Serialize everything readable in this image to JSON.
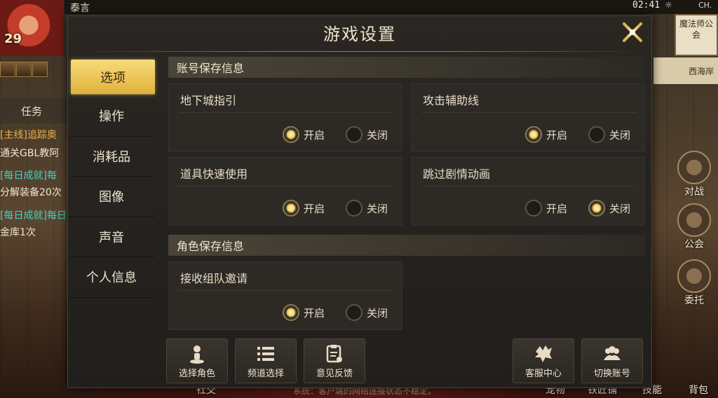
{
  "status_bar": {
    "player_name": "泰言",
    "time": "02:41",
    "status_icon": "☼",
    "carrier": "CH."
  },
  "player": {
    "level": "29"
  },
  "left_panel": {
    "task_tab": "任务",
    "quests": [
      {
        "tag": "[主线]",
        "text": "追踪奥"
      },
      {
        "tag": "",
        "text": "通关GBL教阿"
      },
      {
        "tag": "[每日成就]",
        "text": "每"
      },
      {
        "tag": "",
        "text": "分解装备20次"
      },
      {
        "tag": "[每日成就]",
        "text": "每日"
      },
      {
        "tag": "",
        "text": "金库1次"
      }
    ]
  },
  "right_panel": {
    "guild_sign": "魔法师公会",
    "region_sign": "西海岸",
    "buttons": [
      {
        "label": "对战",
        "icon": "battle-icon"
      },
      {
        "label": "公会",
        "icon": "guild-icon"
      },
      {
        "label": "委托",
        "icon": "commission-icon"
      },
      {
        "label": "背包",
        "icon": "backpack-icon"
      }
    ]
  },
  "bottom_bar": {
    "social": "社交",
    "pet": "宠物",
    "shop": "铁匠铺",
    "skill": "技能",
    "notice": "系统：客户端的网络连接状态不稳定。"
  },
  "dialog": {
    "title": "游戏设置",
    "sidebar": [
      "选项",
      "操作",
      "消耗品",
      "图像",
      "声音",
      "个人信息"
    ],
    "active_index": 0,
    "sections": [
      {
        "header": "账号保存信息",
        "settings": [
          {
            "label": "地下城指引",
            "on": true
          },
          {
            "label": "攻击辅助线",
            "on": true
          },
          {
            "label": "道具快速使用",
            "on": true
          },
          {
            "label": "跳过剧情动画",
            "on": false
          }
        ]
      },
      {
        "header": "角色保存信息",
        "settings": [
          {
            "label": "接收组队邀请",
            "on": true
          }
        ]
      }
    ],
    "radio_on_label": "开启",
    "radio_off_label": "关闭",
    "actions": [
      {
        "label": "选择角色",
        "icon": "character-select-icon"
      },
      {
        "label": "频道选择",
        "icon": "channel-list-icon"
      },
      {
        "label": "意见反馈",
        "icon": "feedback-icon"
      },
      {
        "label": "客服中心",
        "icon": "customer-service-icon"
      },
      {
        "label": "切换账号",
        "icon": "switch-account-icon"
      }
    ]
  }
}
